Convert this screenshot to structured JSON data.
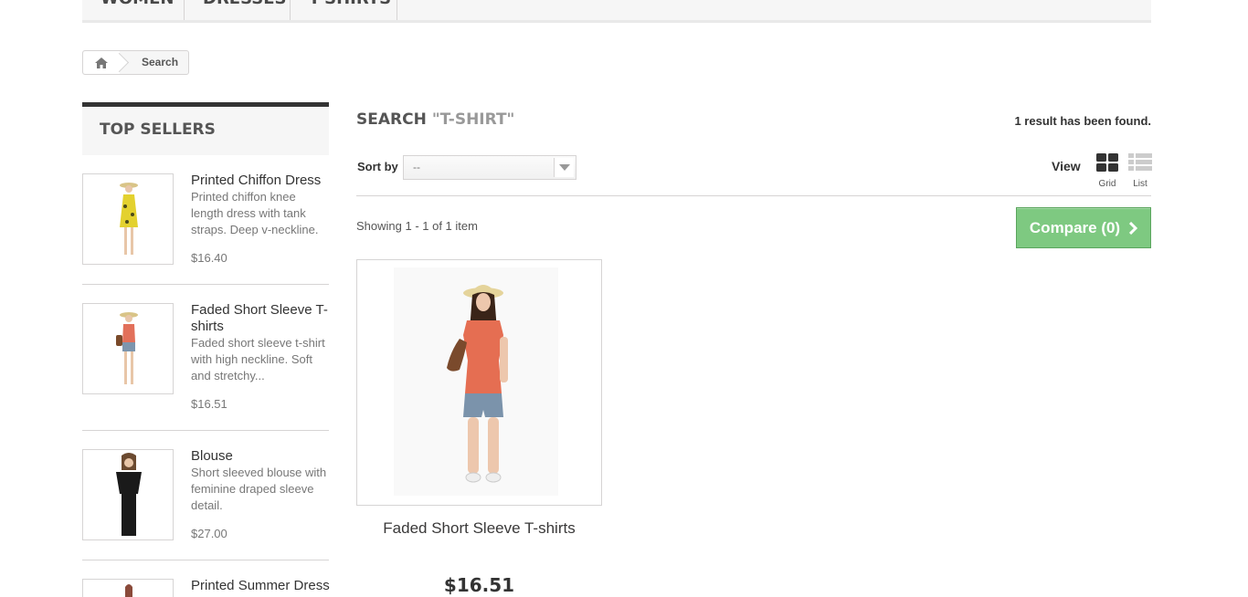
{
  "nav": {
    "items": [
      "Women",
      "Dresses",
      "T-shirts"
    ]
  },
  "breadcrumb": {
    "home_icon": "home-icon",
    "current": "Search"
  },
  "sidebar": {
    "title": "TOP SELLERS",
    "items": [
      {
        "name": "Printed Chiffon Dress",
        "description": "Printed chiffon knee length dress with tank straps. Deep v-neckline.",
        "price": "$16.40"
      },
      {
        "name": "Faded Short Sleeve T-shirts",
        "description": "Faded short sleeve t-shirt with high neckline. Soft and stretchy...",
        "price": "$16.51"
      },
      {
        "name": "Blouse",
        "description": "Short sleeved blouse with feminine draped sleeve detail.",
        "price": "$27.00"
      },
      {
        "name": "Printed Summer Dress",
        "description": "",
        "price": ""
      }
    ]
  },
  "search": {
    "label": "SEARCH",
    "term": "\"T-SHIRT\"",
    "result_count": "1 result has been found."
  },
  "toolbar": {
    "sort_label": "Sort by",
    "sort_value": "--",
    "view_label": "View",
    "grid_label": "Grid",
    "list_label": "List",
    "showing": "Showing 1 - 1 of 1 item",
    "compare_label": "Compare (0)"
  },
  "product": {
    "name": "Faded Short Sleeve T-shirts",
    "price": "$16.51"
  },
  "colors": {
    "compare_green": "#7ec981",
    "heading_dark": "#333333",
    "muted_text": "#777777"
  }
}
